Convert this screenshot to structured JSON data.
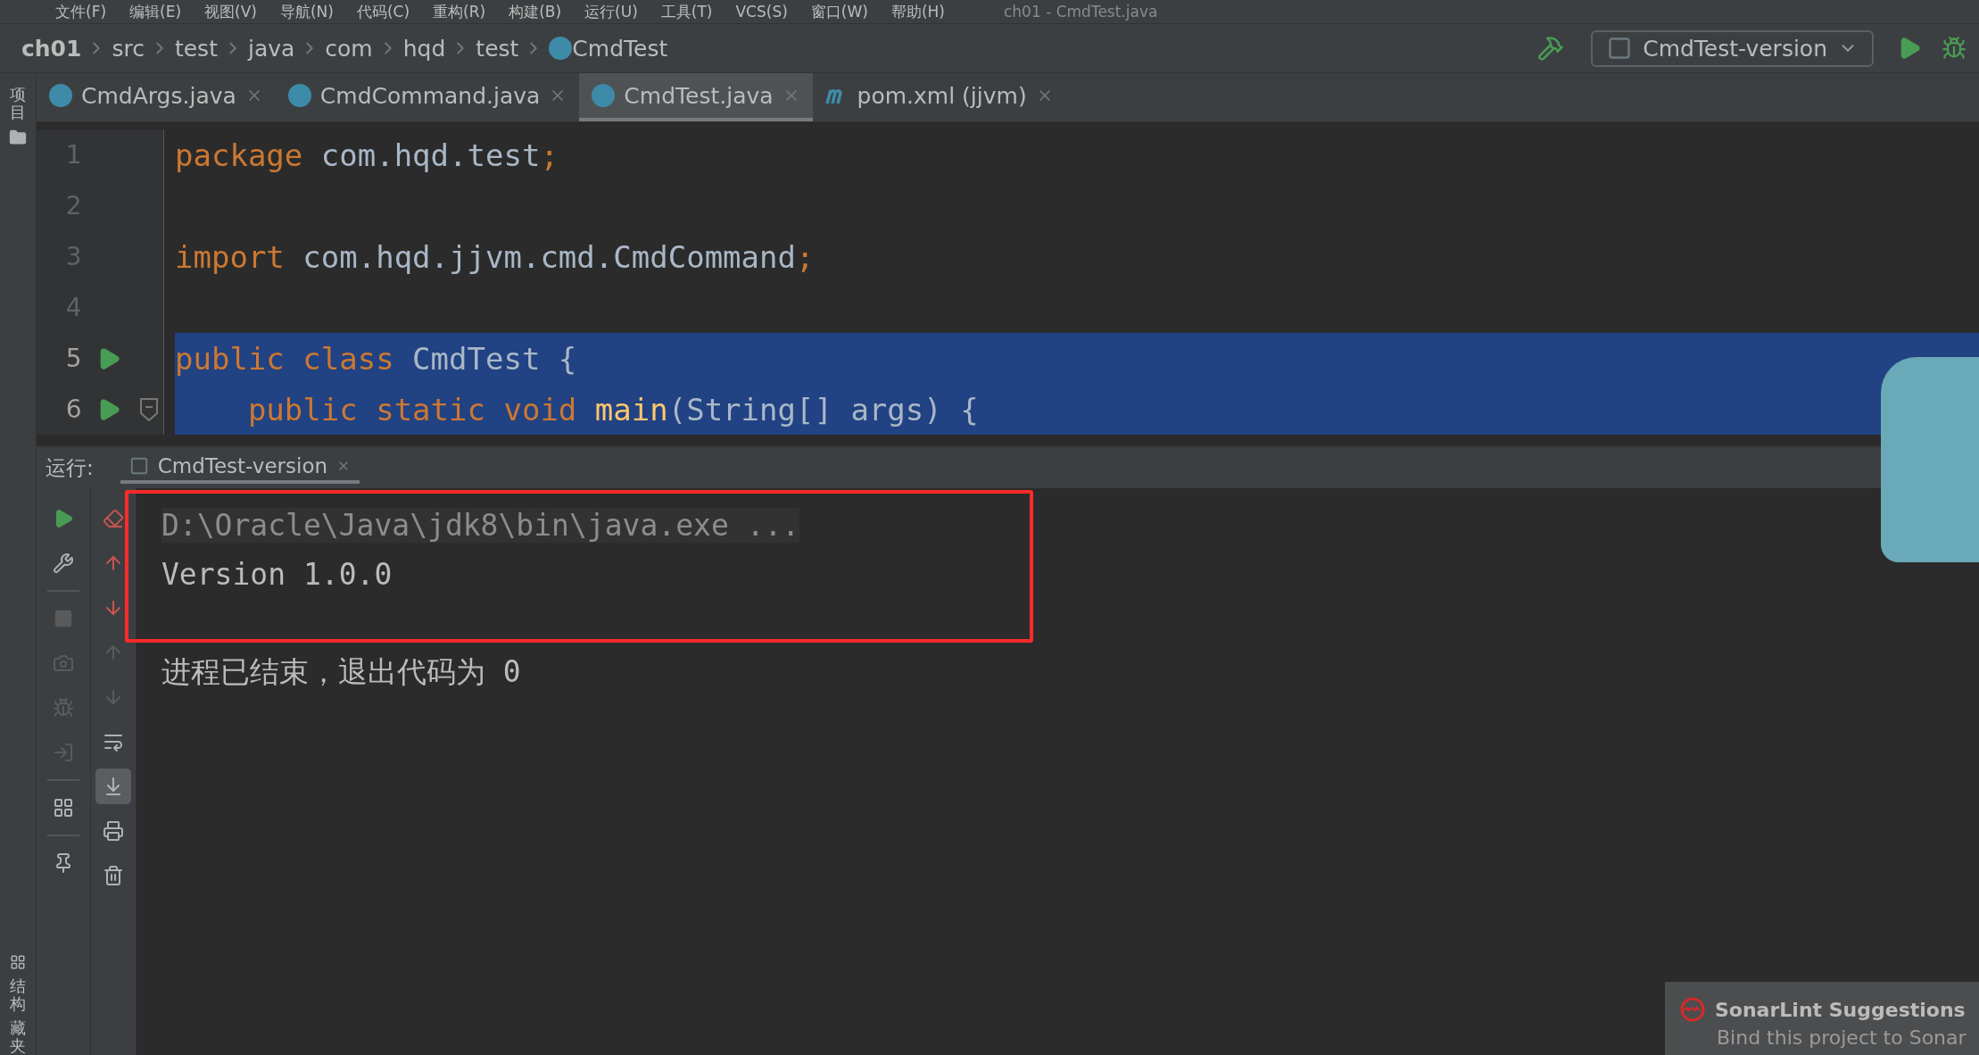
{
  "menu_bar": {
    "items": [
      "文件(F)",
      "编辑(E)",
      "视图(V)",
      "导航(N)",
      "代码(C)",
      "重构(R)",
      "构建(B)",
      "运行(U)",
      "工具(T)",
      "VCS(S)",
      "窗口(W)",
      "帮助(H)"
    ],
    "title": "ch01 - CmdTest.java"
  },
  "breadcrumbs": [
    {
      "label": "ch01",
      "kind": "project"
    },
    {
      "label": "src",
      "kind": "folder"
    },
    {
      "label": "test",
      "kind": "folder"
    },
    {
      "label": "java",
      "kind": "folder"
    },
    {
      "label": "com",
      "kind": "folder"
    },
    {
      "label": "hqd",
      "kind": "folder"
    },
    {
      "label": "test",
      "kind": "folder"
    },
    {
      "label": "CmdTest",
      "kind": "class"
    }
  ],
  "run_config": {
    "label": "CmdTest-version"
  },
  "left_stripe": {
    "top": "项目",
    "bottom": [
      "结构",
      "藏夹"
    ]
  },
  "tabs": [
    {
      "label": "CmdArgs.java",
      "kind": "java",
      "selected": false
    },
    {
      "label": "CmdCommand.java",
      "kind": "java",
      "selected": false
    },
    {
      "label": "CmdTest.java",
      "kind": "java",
      "selected": true
    },
    {
      "label": "pom.xml (jjvm)",
      "kind": "maven",
      "selected": false
    }
  ],
  "editor": {
    "lines": [
      {
        "number": "1",
        "runnable": false,
        "foldable": false,
        "highlighted": false,
        "tokens": [
          {
            "text": "package",
            "kind": "keyword"
          },
          {
            "text": " com.hqd.test",
            "kind": "plain"
          },
          {
            "text": ";",
            "kind": "keyword"
          }
        ]
      },
      {
        "number": "2",
        "runnable": false,
        "foldable": false,
        "highlighted": false
      },
      {
        "number": "3",
        "runnable": false,
        "foldable": false,
        "highlighted": false,
        "tokens": [
          {
            "text": "import",
            "kind": "keyword"
          },
          {
            "text": " com.hqd.jjvm.cmd.CmdCommand",
            "kind": "plain"
          },
          {
            "text": ";",
            "kind": "keyword"
          }
        ]
      },
      {
        "number": "4",
        "runnable": false,
        "foldable": false,
        "highlighted": false
      },
      {
        "number": "5",
        "runnable": true,
        "foldable": false,
        "highlighted": true,
        "tokens": [
          {
            "text": "public class",
            "kind": "keyword"
          },
          {
            "text": " CmdTest {",
            "kind": "plain"
          }
        ]
      },
      {
        "number": "6",
        "runnable": true,
        "foldable": true,
        "highlighted": true,
        "tokens": [
          {
            "text": "    public static void ",
            "kind": "keyword"
          },
          {
            "text": "main",
            "kind": "method"
          },
          {
            "text": "(String[] args) {",
            "kind": "plain"
          }
        ]
      }
    ]
  },
  "run_panel": {
    "label": "运行:",
    "tab": "CmdTest-version",
    "console": [
      {
        "text": "D:\\Oracle\\Java\\jdk8\\bin\\java.exe ...",
        "kind": "command"
      },
      {
        "text": "Version 1.0.0",
        "kind": "output"
      },
      {
        "kind": "blank"
      },
      {
        "text": "进程已结束，退出代码为 0",
        "kind": "output"
      }
    ]
  },
  "notification": {
    "title": "SonarLint Suggestions",
    "body": "Bind this project to Sonar"
  }
}
